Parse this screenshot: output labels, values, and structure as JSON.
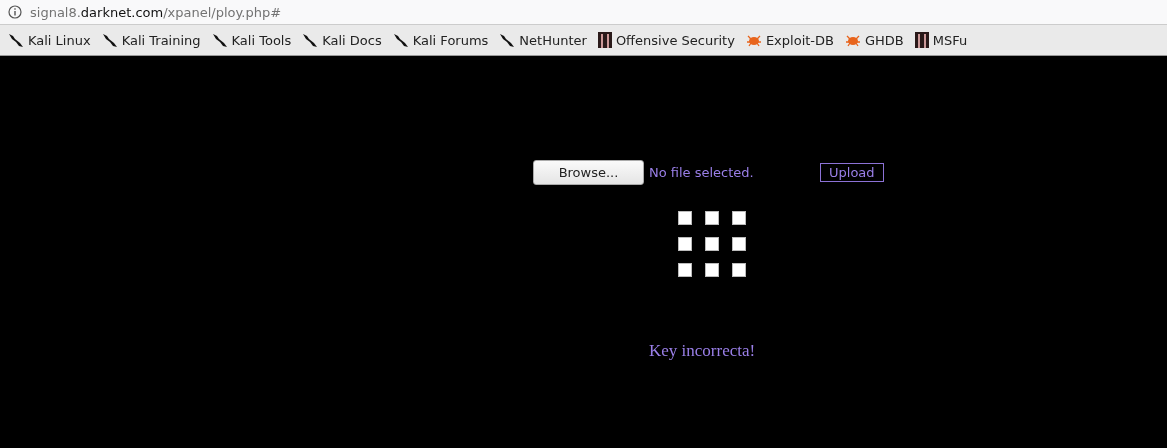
{
  "address_bar": {
    "url": "signal8.**darknet.com**/xpanel/ploy.php#"
  },
  "bookmarks": [
    {
      "label": "Kali Linux",
      "kind": "kali"
    },
    {
      "label": "Kali Training",
      "kind": "kali"
    },
    {
      "label": "Kali Tools",
      "kind": "kali"
    },
    {
      "label": "Kali Docs",
      "kind": "kali"
    },
    {
      "label": "Kali Forums",
      "kind": "kali"
    },
    {
      "label": "NetHunter",
      "kind": "kali"
    },
    {
      "label": "Offensive Security",
      "kind": "offsec"
    },
    {
      "label": "Exploit-DB",
      "kind": "bug"
    },
    {
      "label": "GHDB",
      "kind": "bug"
    },
    {
      "label": "MSFu",
      "kind": "offsec"
    }
  ],
  "upload_form": {
    "browse_button": "Browse...",
    "file_status": "No file selected.",
    "upload_button": "Upload"
  },
  "checkbox_grid": [
    {
      "checked": false
    },
    {
      "checked": false
    },
    {
      "checked": false
    },
    {
      "checked": false
    },
    {
      "checked": false
    },
    {
      "checked": false
    },
    {
      "checked": false
    },
    {
      "checked": false
    },
    {
      "checked": false
    }
  ],
  "message": "Key incorrecta!"
}
